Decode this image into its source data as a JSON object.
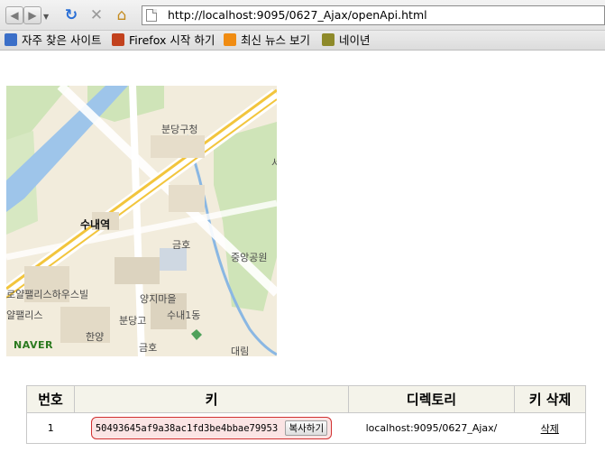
{
  "browser": {
    "url": "http://localhost:9095/0627_Ajax/openApi.html",
    "icons": {
      "back": "back-arrow-icon",
      "forward": "forward-arrow-icon",
      "reload": "reload-icon",
      "stop": "stop-icon",
      "home": "home-icon",
      "page": "page-icon"
    }
  },
  "bookmarks": [
    {
      "label": "자주 찾은 사이트",
      "icon": "most-visited-icon"
    },
    {
      "label": "Firefox 시작 하기",
      "icon": "firefox-icon"
    },
    {
      "label": "최신 뉴스 보기",
      "icon": "rss-icon"
    },
    {
      "label": "네이년",
      "icon": "naver-icon"
    }
  ],
  "map": {
    "labels": {
      "district_office": "분당구청",
      "station": "수내역",
      "geumho1": "금호",
      "central_park": "중앙공원",
      "yangji": "양지마을",
      "palace1": "로얄팰리스하우스빌",
      "palace2": "얄팰리스",
      "bundang_high": "분당고",
      "sunae1": "수내1동",
      "hanyang": "한양",
      "geumho2": "금호",
      "daerim": "대림",
      "edge": "서"
    },
    "logo": "NAVER"
  },
  "table": {
    "headers": [
      "번호",
      "키",
      "디렉토리",
      "키 삭제"
    ],
    "rows": [
      {
        "number": "1",
        "key": "50493645af9a38ac1fd3be4bbae79953",
        "copy_label": "복사하기",
        "directory": "localhost:9095/0627_Ajax/",
        "delete_label": "삭제"
      }
    ]
  }
}
